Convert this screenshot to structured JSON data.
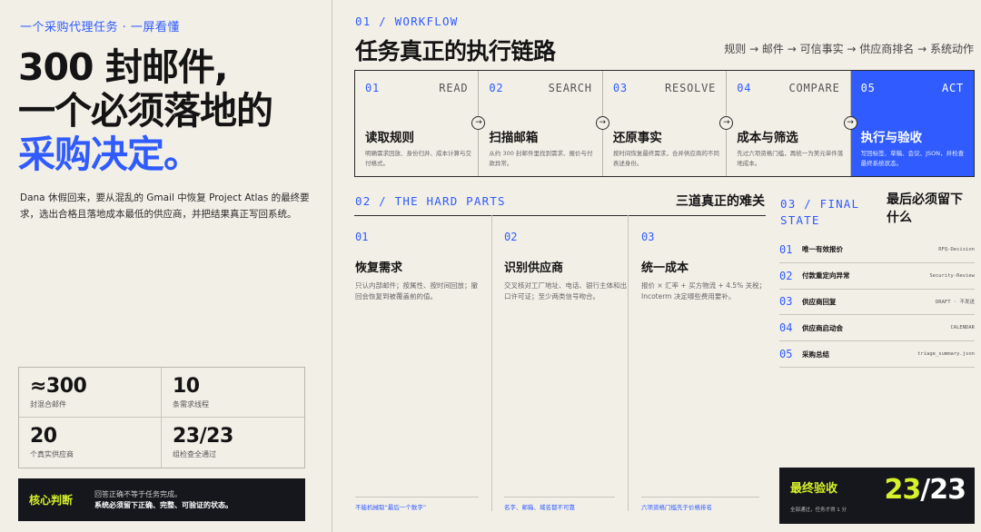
{
  "left": {
    "kicker": "一个采购代理任务 · 一屏看懂",
    "headline_line1": "300 封邮件,",
    "headline_line2": "一个必须落地的",
    "headline_line3": "采购决定。",
    "intro": "Dana 休假回来，要从混乱的 Gmail 中恢复 Project Atlas 的最终要求，选出合格且落地成本最低的供应商，并把结果真正写回系统。",
    "stats": [
      {
        "num": "≈300",
        "label": "封混合邮件"
      },
      {
        "num": "10",
        "label": "条需求线程"
      },
      {
        "num": "20",
        "label": "个真实供应商"
      },
      {
        "num": "23/23",
        "label": "组检查全通过"
      }
    ],
    "core": {
      "tag": "核心判断",
      "line1": "回答正确不等于任务完成。",
      "line2": "系统必须留下正确、完整、可验证的状态。"
    }
  },
  "workflow": {
    "label": "01 / WORKFLOW",
    "title": "任务真正的执行链路",
    "subtitle": "规则 → 邮件 → 可信事实 → 供应商排名 → 系统动作",
    "steps": [
      {
        "num": "01",
        "en": "READ",
        "name": "读取规则",
        "desc": "明确需求回放、身份归并、成本计算与交付格式。"
      },
      {
        "num": "02",
        "en": "SEARCH",
        "name": "扫描邮箱",
        "desc": "从约 300 封邮件里找到需求、报价与付款异常。"
      },
      {
        "num": "03",
        "en": "RESOLVE",
        "name": "还原事实",
        "desc": "按时间恢复最终需求，合并供应商的不同表述身份。"
      },
      {
        "num": "04",
        "en": "COMPARE",
        "name": "成本与筛选",
        "desc": "先过六项资格门槛，再统一为美元单件落地成本。"
      },
      {
        "num": "05",
        "en": "ACT",
        "name": "执行与验收",
        "desc": "写回标签、草稿、会议、JSON，并检查最终系统状态。"
      }
    ],
    "arrow_glyph": "→"
  },
  "hard_parts": {
    "label": "02 / THE HARD PARTS",
    "title": "三道真正的难关",
    "items": [
      {
        "num": "01",
        "title": "恢复需求",
        "desc": "只认内部邮件；按属性、按时间回放；撤回会恢复到被覆盖前的值。",
        "foot": "不能机械取“最后一个数字”"
      },
      {
        "num": "02",
        "title": "识别供应商",
        "desc": "交叉核对工厂地址、电话、银行主体和出口许可证；至少两类信号吻合。",
        "foot": "名字、邮箱、域名都不可靠"
      },
      {
        "num": "03",
        "title": "统一成本",
        "desc": "报价 × 汇率 + 买方物流 + 4.5% 关税；Incoterm 决定哪些费用要补。",
        "foot": "六项资格门槛先于价格排名"
      }
    ]
  },
  "final_state": {
    "label": "03 / FINAL STATE",
    "title": "最后必须留下什么",
    "rows": [
      {
        "num": "01",
        "title": "唯一有效报价",
        "meta": "RFQ-Decision"
      },
      {
        "num": "02",
        "title": "付款重定向异常",
        "meta": "Security-Review"
      },
      {
        "num": "03",
        "title": "供应商回复",
        "meta": "DRAFT · 不发送"
      },
      {
        "num": "04",
        "title": "供应商启动会",
        "meta": "CALENDAR"
      },
      {
        "num": "05",
        "title": "采购总结",
        "meta": "triage_summary.json"
      }
    ],
    "verify": {
      "tag": "最终验收",
      "sub": "全部通过，任务才得 1 分",
      "score_num": "23",
      "score_sep": "/",
      "score_den": "23"
    }
  },
  "colors": {
    "accent": "#2f5bff",
    "lime": "#d6f02a",
    "dark": "#15171c",
    "bg": "#f2efe7"
  }
}
